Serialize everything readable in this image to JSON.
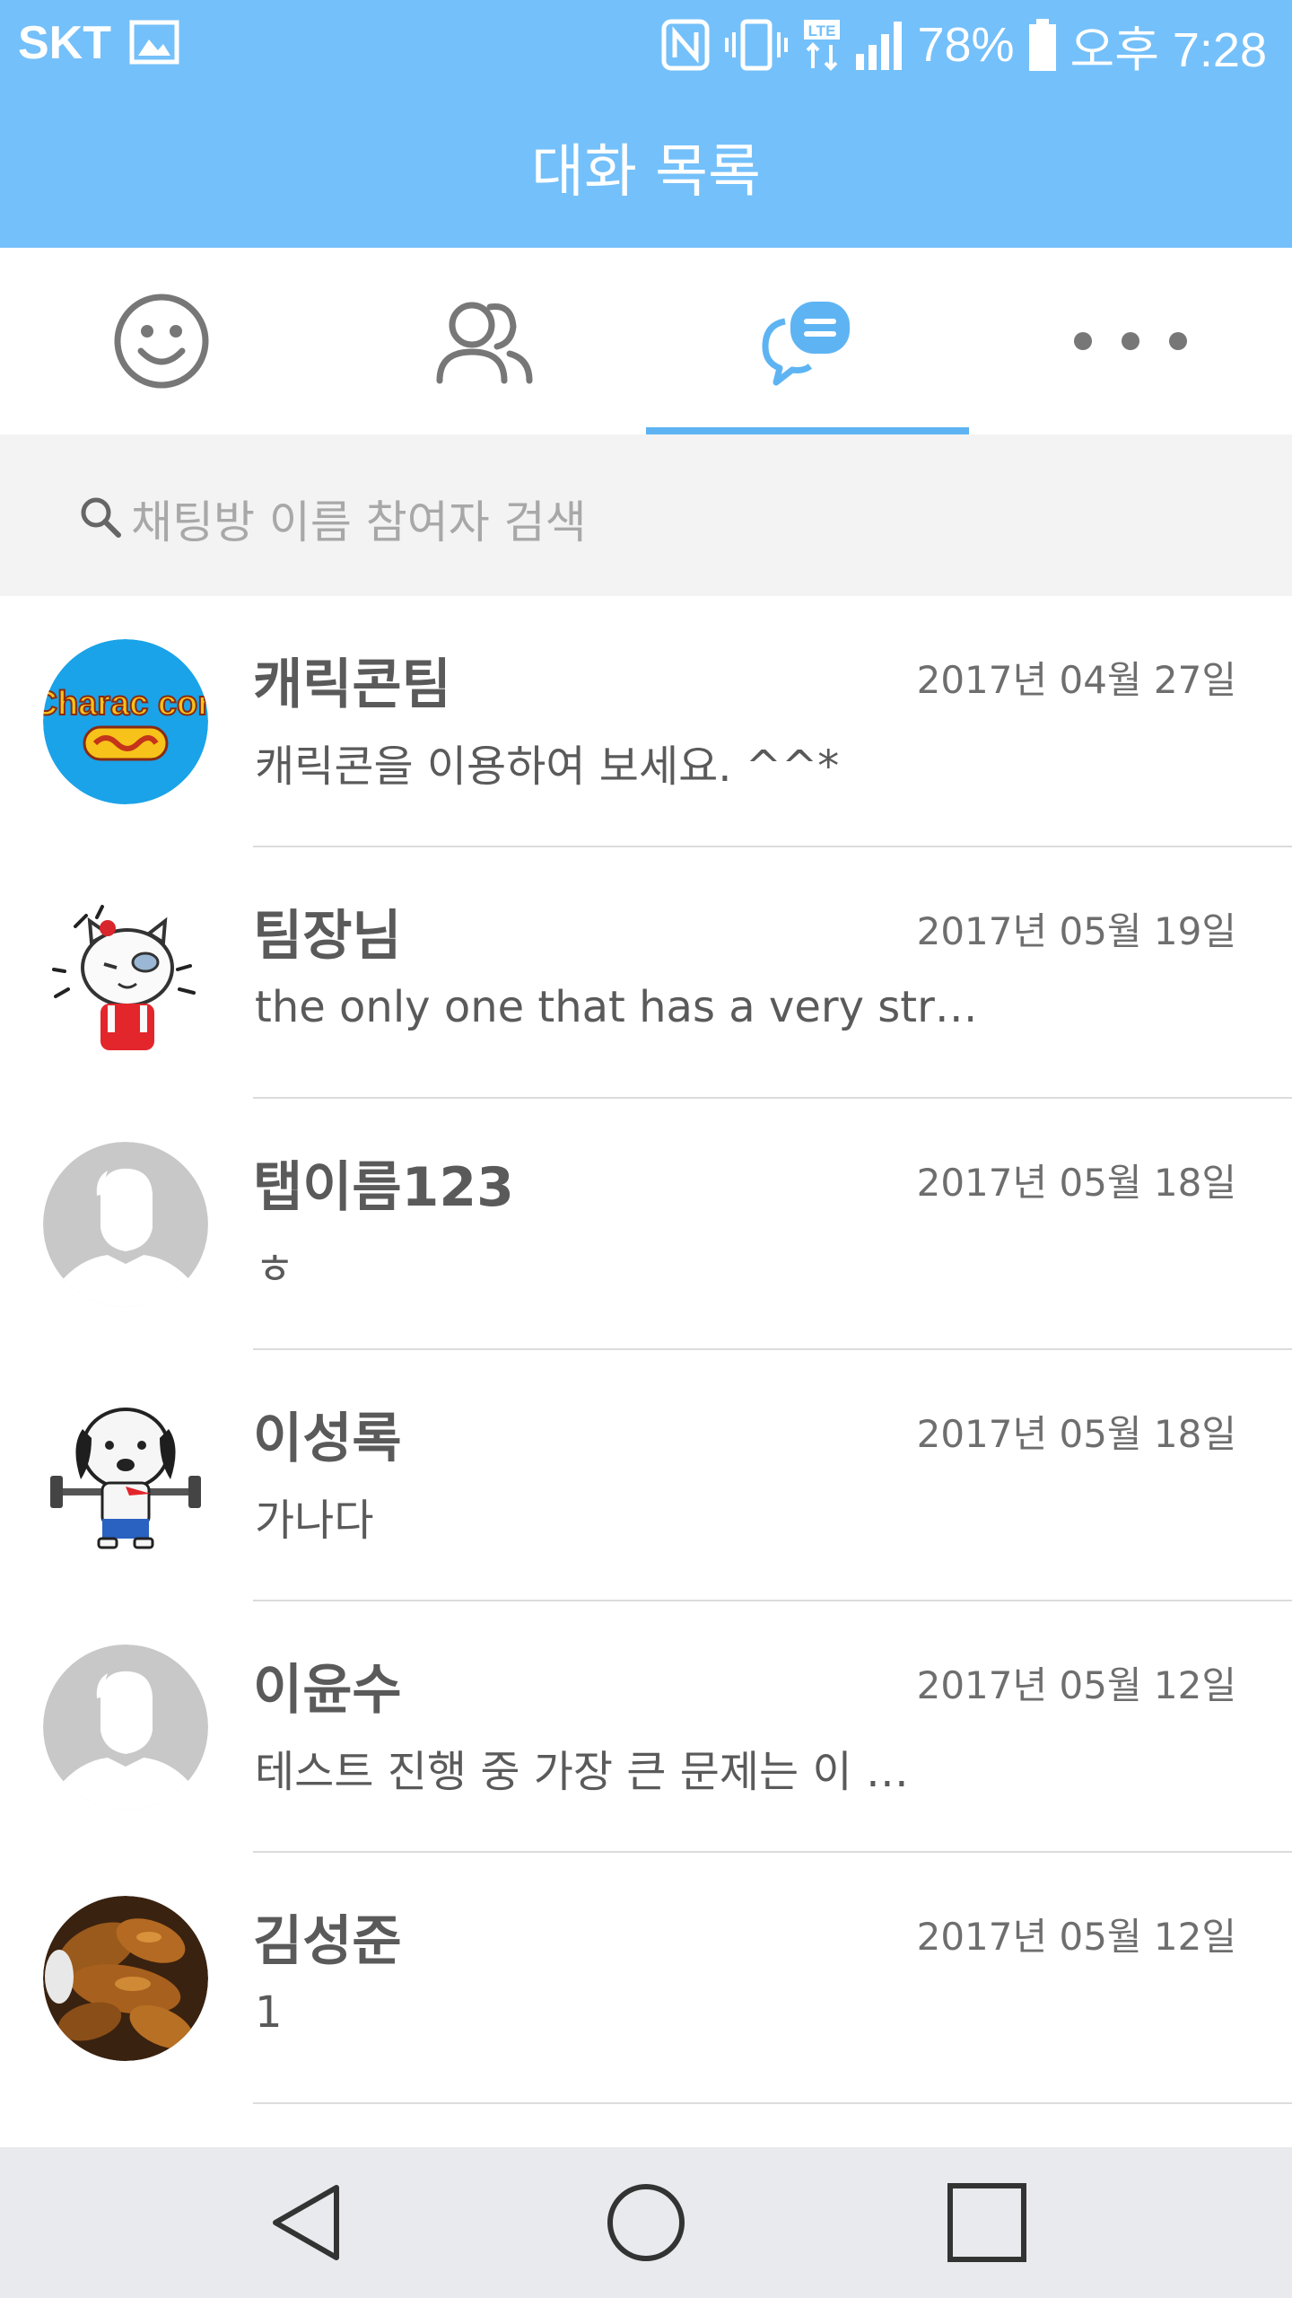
{
  "status_bar": {
    "carrier": "SKT",
    "battery": "78%",
    "time": "오후 7:28",
    "icons": [
      "image-icon",
      "nfc-icon",
      "vibrate-icon",
      "lte-icon",
      "signal-icon",
      "battery-icon"
    ]
  },
  "header": {
    "title": "대화 목록"
  },
  "tabs": [
    {
      "icon": "smiley-icon",
      "active": false
    },
    {
      "icon": "friends-icon",
      "active": false
    },
    {
      "icon": "chat-icon",
      "active": true
    },
    {
      "icon": "more-icon",
      "active": false
    }
  ],
  "search": {
    "placeholder": "채팅방 이름 참여자 검색"
  },
  "chats": [
    {
      "name": "캐릭콘팀",
      "date": "2017년 04월 27일",
      "message": "캐릭콘을 이용하여 보세요. ^^*",
      "avatar": "characcon-logo"
    },
    {
      "name": "팀장님",
      "date": "2017년 05월 19일",
      "message": "the only one that has a very str…",
      "avatar": "cat-sticker"
    },
    {
      "name": "탭이름123",
      "date": "2017년 05월 18일",
      "message": "ㅎ",
      "avatar": "default-avatar"
    },
    {
      "name": "이성록",
      "date": "2017년 05월 18일",
      "message": "가나다",
      "avatar": "dog-sticker"
    },
    {
      "name": "이윤수",
      "date": "2017년 05월 12일",
      "message": "테스트 진행 중 가장 큰 문제는 이 …",
      "avatar": "default-avatar"
    },
    {
      "name": "김성준",
      "date": "2017년 05월 12일",
      "message": "1",
      "avatar": "food-photo"
    }
  ],
  "brand_logo_text": "Charac con",
  "colors": {
    "header": "#74c0fa",
    "accent": "#5eb4f3",
    "navbar": "#e9eaed"
  }
}
